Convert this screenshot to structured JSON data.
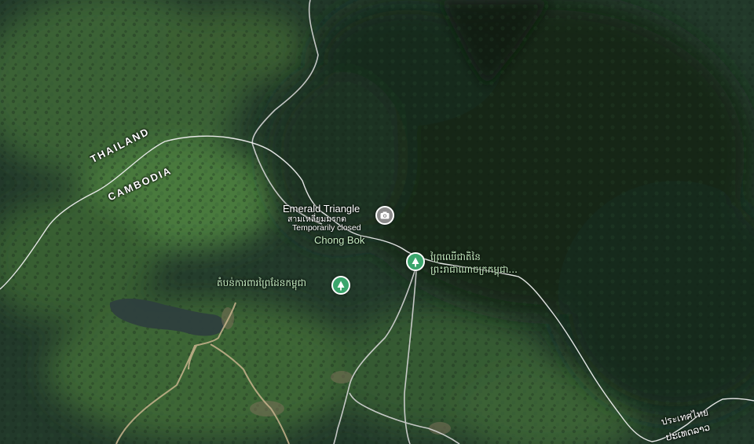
{
  "map": {
    "type": "satellite",
    "colors": {
      "forest_dark": "#1b2f1f",
      "forest_mid": "#27452a",
      "forest_light": "#3f6a35",
      "water": "#2e3f3e",
      "road": "#d8d8d8",
      "border": "#e6e6e6",
      "park_pin": "#3aa56c",
      "photo_pin": "#8a8a8a"
    }
  },
  "country_labels": {
    "thailand": "THAILAND",
    "cambodia": "CAMBODIA",
    "thai_script": "ประเทศไทย",
    "lao_script": "ປະເທດລາວ"
  },
  "places": {
    "emerald_triangle": {
      "name": "Emerald Triangle",
      "thai_name": "สามเหลี่ยมมรกต",
      "status": "Temporarily closed",
      "icon": "camera-icon"
    },
    "chong_bok": {
      "name": "Chong Bok"
    },
    "khmer_forest_1": {
      "name": "ព្រៃឈើជាតិនៃព្រះរាជាណាចក្រកម្ពុជា...",
      "icon": "tree-icon"
    },
    "khmer_forest_2": {
      "name": "តំបន់ការពារព្រៃដែនកម្ពុជា",
      "icon": "tree-icon"
    }
  }
}
